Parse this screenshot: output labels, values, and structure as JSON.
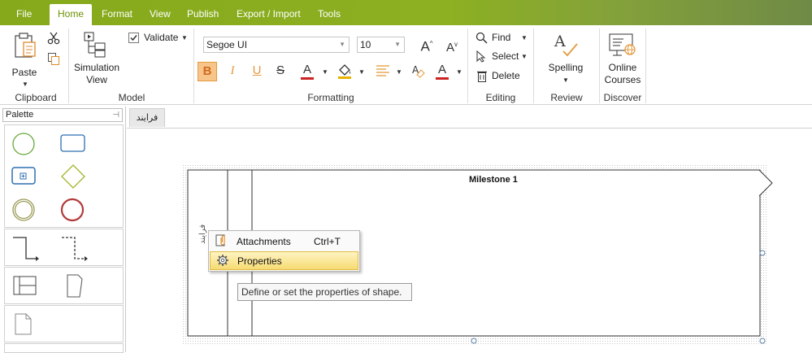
{
  "tabs": [
    {
      "label": "File",
      "active": false
    },
    {
      "label": "Home",
      "active": true
    },
    {
      "label": "Format",
      "active": false
    },
    {
      "label": "View",
      "active": false
    },
    {
      "label": "Publish",
      "active": false
    },
    {
      "label": "Export / Import",
      "active": false
    },
    {
      "label": "Tools",
      "active": false
    }
  ],
  "ribbon": {
    "clipboard": {
      "paste": "Paste",
      "group": "Clipboard"
    },
    "model": {
      "simulation_line1": "Simulation",
      "simulation_line2": "View",
      "validate": "Validate",
      "group": "Model"
    },
    "formatting": {
      "font_family": "Segoe UI",
      "font_size": "10",
      "group": "Formatting"
    },
    "editing": {
      "find": "Find",
      "select": "Select",
      "delete": "Delete",
      "group": "Editing"
    },
    "review": {
      "spelling": "Spelling",
      "group": "Review"
    },
    "discover": {
      "online_line1": "Online",
      "online_line2": "Courses",
      "group": "Discover"
    }
  },
  "palette": {
    "title": "Palette",
    "pin_icon": "pin-icon"
  },
  "document": {
    "tab_label": "فرایند"
  },
  "diagram": {
    "milestone": "Milestone 1",
    "lane_label": "فرایند"
  },
  "context_menu": {
    "items": [
      {
        "label": "Attachments",
        "shortcut": "Ctrl+T",
        "icon": "attachment-icon",
        "highlighted": false
      },
      {
        "label": "Properties",
        "shortcut": "",
        "icon": "gear-icon",
        "highlighted": true
      }
    ]
  },
  "tooltip": {
    "text": "Define or set the properties of shape."
  },
  "colors": {
    "accent": "#8cb021",
    "start_event": "#6aa83a",
    "end_event": "#b23a3a",
    "task": "#2e6fb0",
    "gateway": "#a4b42a"
  }
}
